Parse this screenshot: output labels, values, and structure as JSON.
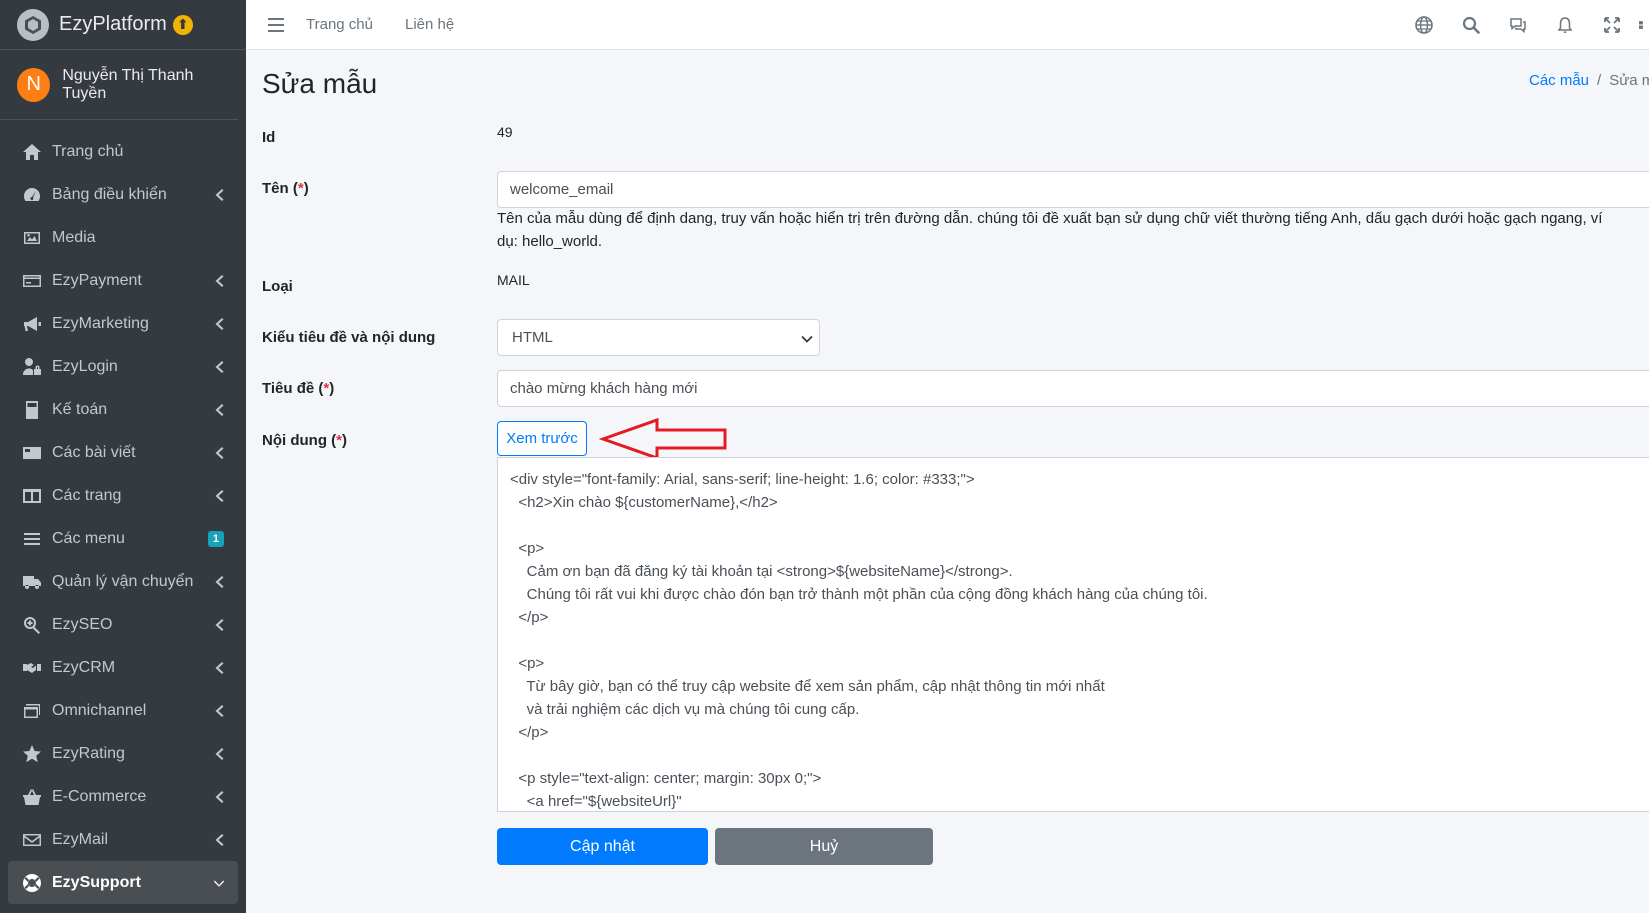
{
  "brand": {
    "name": "EzyPlatform",
    "badge": "⬆"
  },
  "user": {
    "initial": "N",
    "name": "Nguyễn Thị Thanh Tuyền"
  },
  "sidebar": {
    "items": [
      {
        "label": "Trang chủ",
        "icon": "home-icon",
        "has_children": false
      },
      {
        "label": "Bảng điều khiển",
        "icon": "dashboard-icon",
        "has_children": true
      },
      {
        "label": "Media",
        "icon": "image-icon",
        "has_children": false
      },
      {
        "label": "EzyPayment",
        "icon": "credit-card-icon",
        "has_children": true
      },
      {
        "label": "EzyMarketing",
        "icon": "megaphone-icon",
        "has_children": true
      },
      {
        "label": "EzyLogin",
        "icon": "user-lock-icon",
        "has_children": true
      },
      {
        "label": "Kế toán",
        "icon": "calculator-icon",
        "has_children": true
      },
      {
        "label": "Các bài viết",
        "icon": "newspaper-icon",
        "has_children": true
      },
      {
        "label": "Các trang",
        "icon": "columns-icon",
        "has_children": true
      },
      {
        "label": "Các menu",
        "icon": "bars-icon",
        "badge": "1"
      },
      {
        "label": "Quản lý vận chuyển",
        "icon": "truck-icon",
        "has_children": true
      },
      {
        "label": "EzySEO",
        "icon": "search-plus-icon",
        "has_children": true
      },
      {
        "label": "EzyCRM",
        "icon": "handshake-icon",
        "has_children": true
      },
      {
        "label": "Omnichannel",
        "icon": "window-restore-icon",
        "has_children": true
      },
      {
        "label": "EzyRating",
        "icon": "star-icon",
        "has_children": true
      },
      {
        "label": "E-Commerce",
        "icon": "shopping-basket-icon",
        "has_children": true
      },
      {
        "label": "EzyMail",
        "icon": "envelope-icon",
        "has_children": true
      },
      {
        "label": "EzySupport",
        "icon": "life-ring-icon",
        "has_children": true,
        "active": true
      }
    ]
  },
  "topbar": {
    "home": "Trang chủ",
    "contact": "Liên hệ"
  },
  "page": {
    "title": "Sửa mẫu",
    "breadcrumb_parent": "Các mẫu",
    "breadcrumb_sep": "/",
    "breadcrumb_current": "Sửa mẫu"
  },
  "form": {
    "id_label": "Id",
    "id_value": "49",
    "name_label": "Tên (",
    "required_mark": "*",
    "close_paren": ")",
    "name_value": "welcome_email",
    "name_help": "Tên của mẫu dùng để định dang, truy vấn hoặc hiển trị trên đường dẫn. chúng tôi đề xuất bạn sử dụng chữ viết thường tiếng Anh, dấu gạch dưới hoặc gạch ngang, ví dụ: hello_world.",
    "type_label": "Loại",
    "type_value": "MAIL",
    "format_label": "Kiểu tiêu đề và nội dung",
    "format_value": "HTML",
    "subject_label": "Tiêu đề (",
    "subject_value": "chào mừng khách hàng mới",
    "content_label": "Nội dung (",
    "preview_button": "Xem trước",
    "content_value": "<div style=\"font-family: Arial, sans-serif; line-height: 1.6; color: #333;\">\n  <h2>Xin chào ${customerName},</h2>\n\n  <p>\n    Cảm ơn bạn đã đăng ký tài khoản tại <strong>${websiteName}</strong>.\n    Chúng tôi rất vui khi được chào đón bạn trở thành một phần của cộng đồng khách hàng của chúng tôi.\n  </p>\n\n  <p>\n    Từ bây giờ, bạn có thể truy cập website để xem sản phẩm, cập nhật thông tin mới nhất\n    và trải nghiệm các dịch vụ mà chúng tôi cung cấp.\n  </p>\n\n  <p style=\"text-align: center; margin: 30px 0;\">\n    <a href=\"${websiteUrl}\"",
    "update_button": "Cập nhật",
    "cancel_button": "Huỷ"
  },
  "colors": {
    "sidebar_bg": "#343a40",
    "primary": "#007bff",
    "secondary": "#6c757d",
    "required": "#dc3545",
    "annotation_arrow": "#e31b23"
  }
}
